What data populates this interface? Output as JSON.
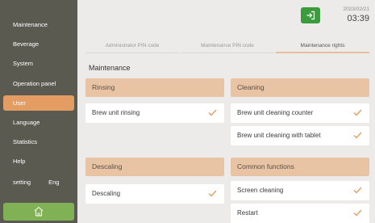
{
  "sidebar": {
    "items": [
      {
        "label": "Maintenance"
      },
      {
        "label": "Beverage"
      },
      {
        "label": "System"
      },
      {
        "label": "Operation panel"
      },
      {
        "label": "User"
      },
      {
        "label": "Language"
      },
      {
        "label": "Statistics"
      },
      {
        "label": "Help"
      }
    ],
    "active_index": 4,
    "lang_left": "setting",
    "lang_right": "Eng"
  },
  "header": {
    "date": "2023/02/21",
    "time": "03:39"
  },
  "tabs": [
    {
      "label": "Administrator PIN code"
    },
    {
      "label": "Maintenance PIN code"
    },
    {
      "label": "Maintenance rights"
    }
  ],
  "active_tab": 2,
  "section_title": "Maintenance",
  "groups": {
    "rinsing": {
      "title": "Rinsing",
      "items": [
        "Brew unit rinsing"
      ]
    },
    "cleaning": {
      "title": "Cleaning",
      "items": [
        "Brew unit cleaning counter",
        "Brew unit cleaning with tablet"
      ]
    },
    "descaling": {
      "title": "Descaling",
      "items": [
        "Descaling"
      ]
    },
    "common": {
      "title": "Common functions",
      "items": [
        "Screen cleaning",
        "Restart"
      ]
    }
  },
  "colors": {
    "sidebar": "#5a5a50",
    "accent": "#e39d63",
    "header_band": "#e8c4a4",
    "check": "#e39d63",
    "home_button": "#80b154",
    "logout_button": "#3c9b3c"
  },
  "icons": {
    "home": "home-icon",
    "logout": "logout-icon",
    "check": "check-icon"
  }
}
